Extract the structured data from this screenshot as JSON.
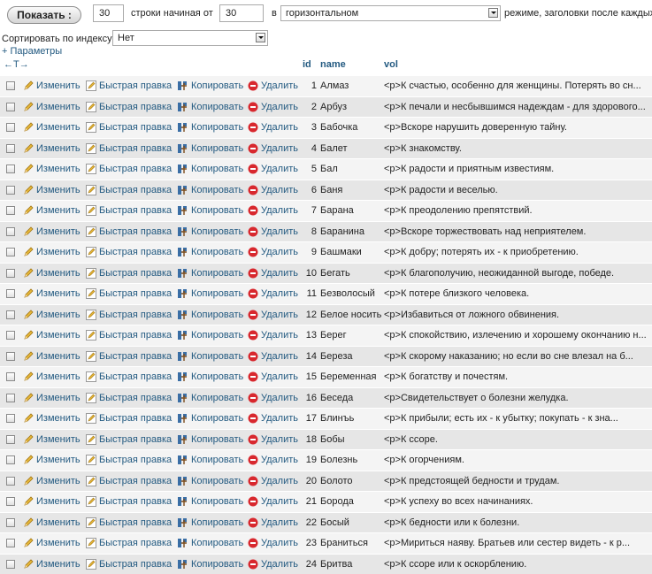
{
  "controls": {
    "show_button": "Показать :",
    "rows_value": "30",
    "rows_label": "строки начиная от",
    "start_value": "30",
    "in_label": "в",
    "mode_value": "горизонтальном",
    "mode_suffix": "режиме, заголовки после каждых",
    "sort_label": "Сортировать по индексу:",
    "sort_value": "Нет",
    "params_link": "+ Параметры",
    "column_arrows": "←T→"
  },
  "columns": [
    "id",
    "name",
    "vol"
  ],
  "actions": {
    "edit": "Изменить",
    "quick_edit": "Быстрая правка",
    "copy": "Копировать",
    "delete": "Удалить"
  },
  "rows": [
    {
      "id": "1",
      "name": "Алмаз",
      "vol": "<p>К счастью, особенно для женщины. Потерять во сн..."
    },
    {
      "id": "2",
      "name": "Арбуз",
      "vol": "<p>К печали и несбывшимся надеждам - для здорового..."
    },
    {
      "id": "3",
      "name": "Бабочка",
      "vol": "<p>Вскоре нарушить доверенную тайну."
    },
    {
      "id": "4",
      "name": "Балет",
      "vol": "<p>К знакомству."
    },
    {
      "id": "5",
      "name": "Бал",
      "vol": "<p>К радости и приятным известиям."
    },
    {
      "id": "6",
      "name": "Баня",
      "vol": "<p>К радости и веселью."
    },
    {
      "id": "7",
      "name": "Барана",
      "vol": "<p>К преодолению препятствий."
    },
    {
      "id": "8",
      "name": "Баранина",
      "vol": "<p>Вскоре торжествовать над неприятелем."
    },
    {
      "id": "9",
      "name": "Башмаки",
      "vol": "<p>К добру; потерять их - к приобретению."
    },
    {
      "id": "10",
      "name": "Бегать",
      "vol": "<p>К благополучию, неожиданной выгоде, победе."
    },
    {
      "id": "11",
      "name": "Безволосый",
      "vol": "<p>К потере близкого человека."
    },
    {
      "id": "12",
      "name": "Белое носить",
      "vol": "<p>Избавиться от ложного обвинения."
    },
    {
      "id": "13",
      "name": "Берег",
      "vol": "<p>К спокойствию, излечению и хорошему окончанию н..."
    },
    {
      "id": "14",
      "name": "Береза",
      "vol": "<p>К скорому наказанию; но если во сне влезал на б..."
    },
    {
      "id": "15",
      "name": "Беременная",
      "vol": "<p>К богатству и почестям."
    },
    {
      "id": "16",
      "name": "Беседа",
      "vol": "<p>Свидетельствует о болезни желудка."
    },
    {
      "id": "17",
      "name": "Блинъь",
      "vol": "<p>К прибыли; есть их - к убытку; покупать - к зна..."
    },
    {
      "id": "18",
      "name": "Бобы",
      "vol": "<p>К ссоре."
    },
    {
      "id": "19",
      "name": "Болезнь",
      "vol": "<p>К огорчениям."
    },
    {
      "id": "20",
      "name": "Болото",
      "vol": "<p>К предстоящей бедности и трудам."
    },
    {
      "id": "21",
      "name": "Борода",
      "vol": "<p>К успеху во всех начинаниях."
    },
    {
      "id": "22",
      "name": "Босый",
      "vol": "<p>К бедности или к болезни."
    },
    {
      "id": "23",
      "name": "Браниться",
      "vol": "<p>Мириться наяву. Братьев или сестер видеть - к р..."
    },
    {
      "id": "24",
      "name": "Бритва",
      "vol": "<p>К ссоре или к оскорблению."
    }
  ]
}
